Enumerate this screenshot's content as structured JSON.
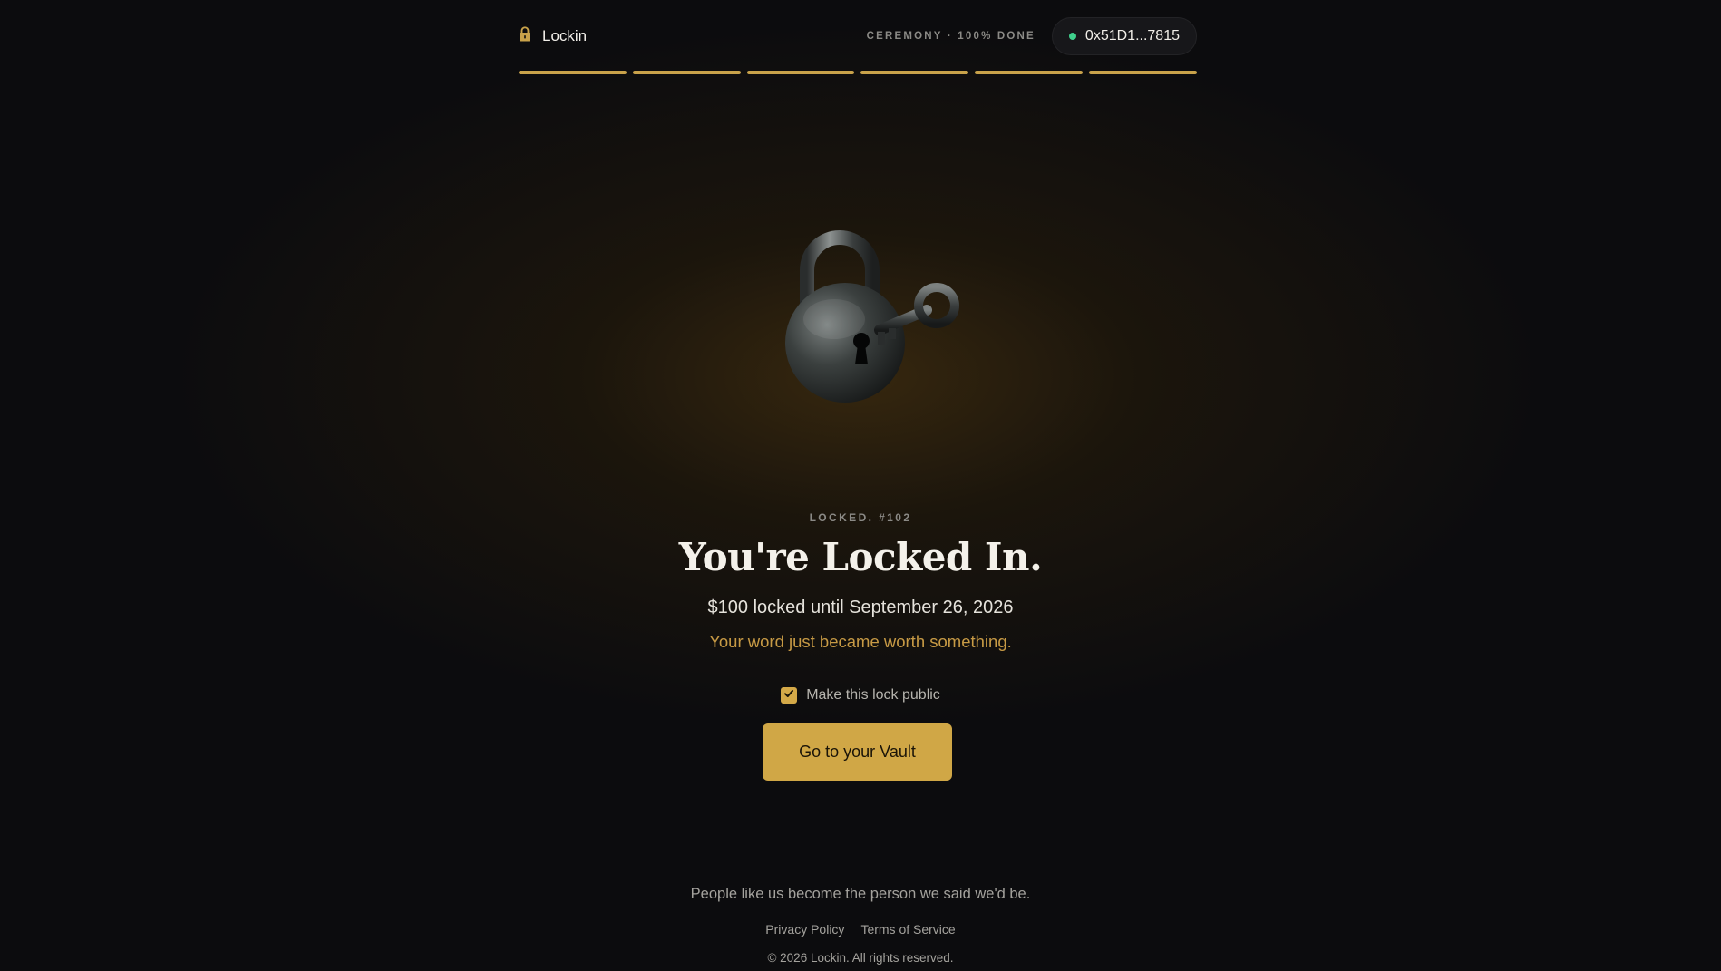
{
  "header": {
    "brand": "Lockin",
    "ceremony_status": "CEREMONY · 100% DONE",
    "wallet_address": "0x51D1...7815"
  },
  "progress": {
    "total_steps": 6,
    "steps_complete": 6,
    "color": "#c9a24a"
  },
  "hero": {
    "eyebrow": "LOCKED. #102",
    "title": "You're Locked In.",
    "subtitle": "$100 locked until September 26, 2026",
    "tagline": "Your word just became worth something."
  },
  "public_toggle": {
    "label": "Make this lock public",
    "checked": true
  },
  "cta": {
    "label": "Go to your Vault"
  },
  "footer": {
    "quote": "People like us become the person we said we'd be.",
    "links": [
      "Privacy Policy",
      "Terms of Service"
    ],
    "copyright": "© 2026 Lockin. All rights reserved."
  },
  "colors": {
    "accent": "#d0a746",
    "tagline": "#c79a45",
    "status_dot": "#3fd08c",
    "background": "#0c0c0e"
  },
  "icons": {
    "brand": "padlock-icon",
    "hero": "padlock-with-key-icon",
    "checkbox": "checkmark-icon"
  }
}
